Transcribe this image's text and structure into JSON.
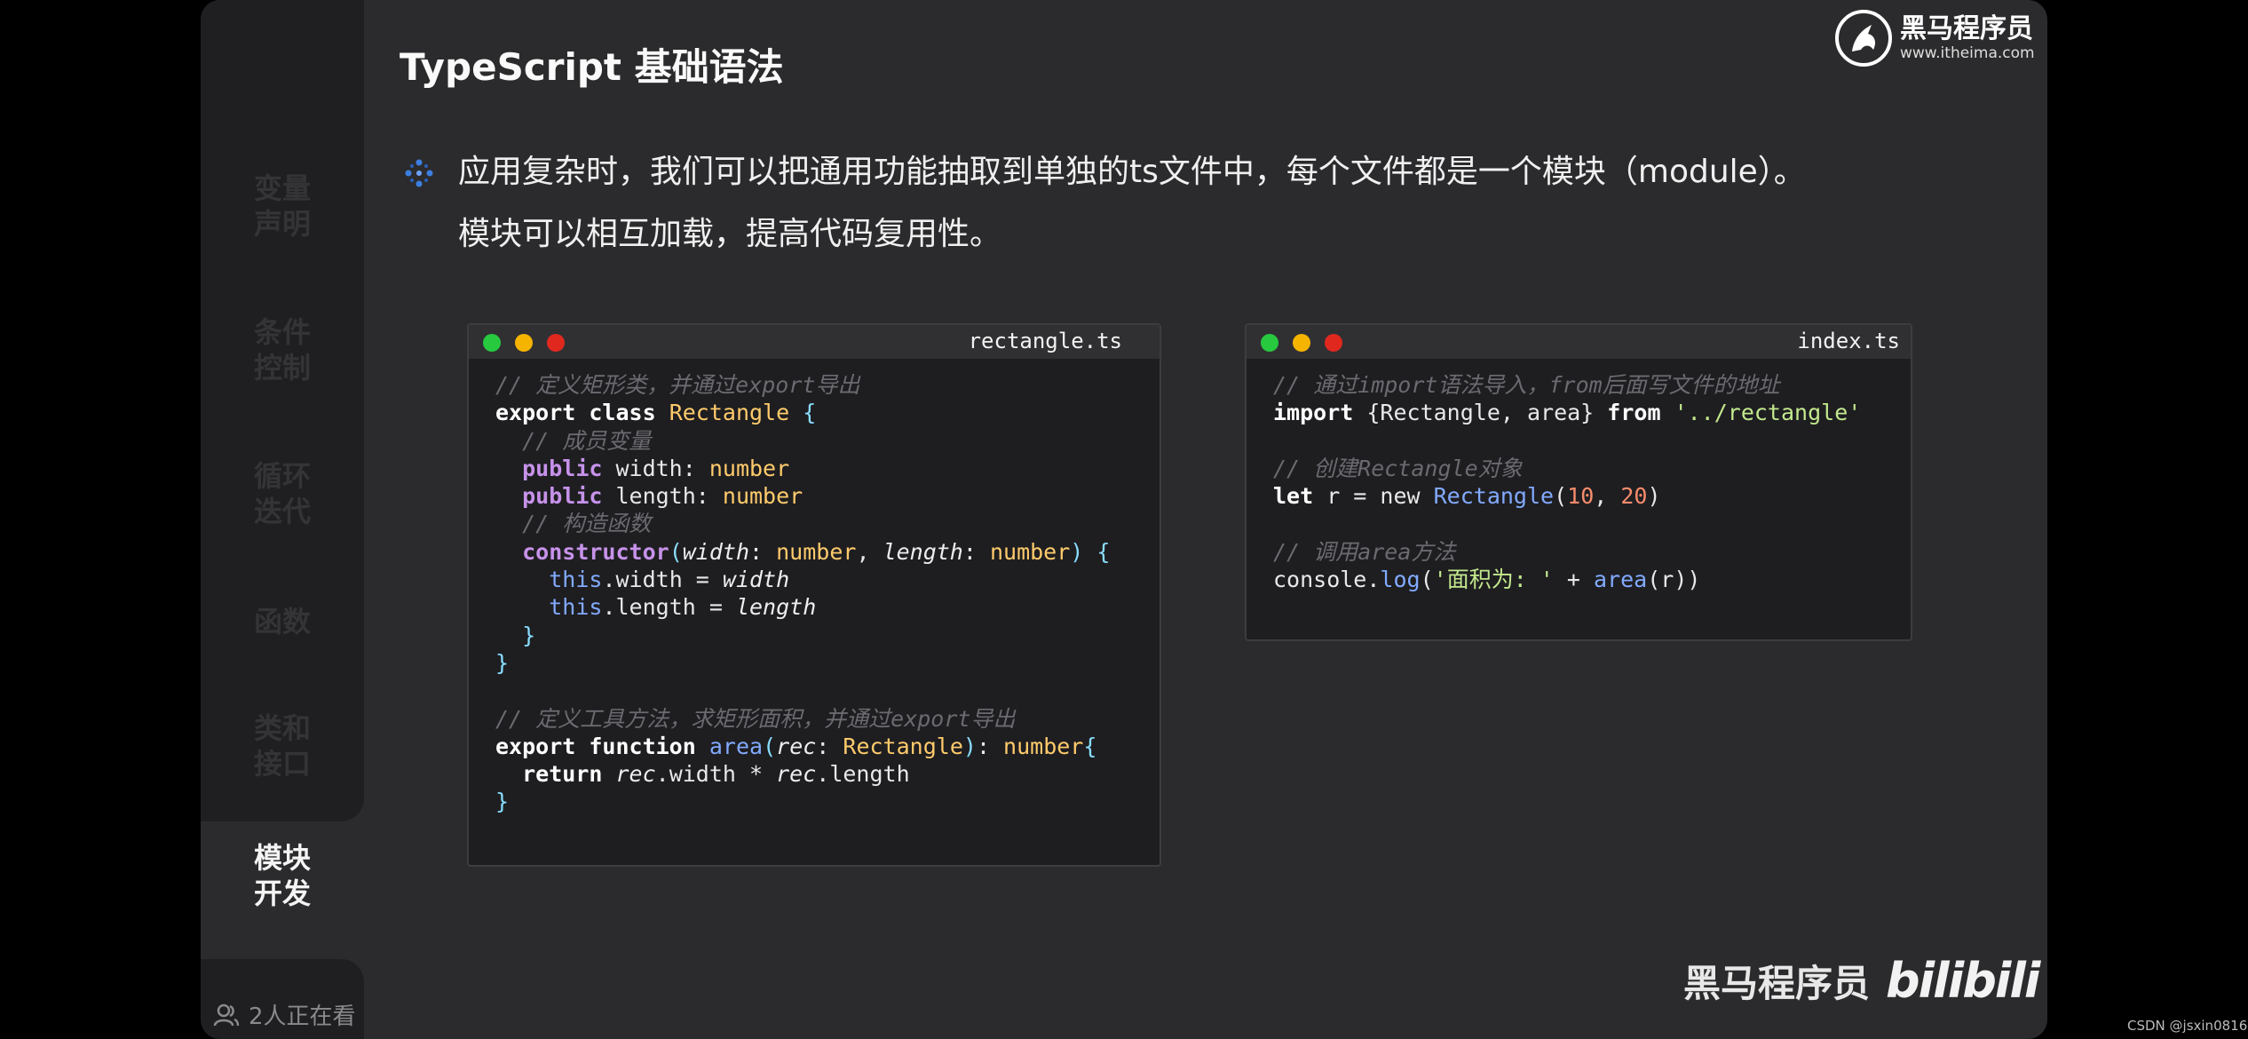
{
  "title": "TypeScript 基础语法",
  "logo": {
    "name": "黑马程序员",
    "url": "www.itheima.com"
  },
  "sidebar": {
    "items": [
      {
        "line1": "变量",
        "line2": "声明"
      },
      {
        "line1": "条件",
        "line2": "控制"
      },
      {
        "line1": "循环",
        "line2": "迭代"
      },
      {
        "line1": "函数",
        "line2": ""
      },
      {
        "line1": "类和",
        "line2": "接口"
      }
    ],
    "active": {
      "line1": "模块",
      "line2": "开发"
    },
    "viewers": "2人正在看"
  },
  "content": {
    "line1": "应用复杂时，我们可以把通用功能抽取到单独的ts文件中，每个文件都是一个模块（module）。",
    "line2": "模块可以相互加载，提高代码复用性。"
  },
  "windows": {
    "left": {
      "filename": "rectangle.ts"
    },
    "right": {
      "filename": "index.ts"
    }
  },
  "code_left": [
    [
      [
        "cm",
        "// 定义矩形类，并通过export导出"
      ]
    ],
    [
      [
        "kw2",
        "export"
      ],
      [
        "t",
        " "
      ],
      [
        "kw2",
        "class"
      ],
      [
        "t",
        " "
      ],
      [
        "ty",
        "Rectangle"
      ],
      [
        "t",
        " "
      ],
      [
        "pn",
        "{"
      ]
    ],
    [
      [
        "t",
        "  "
      ],
      [
        "cm",
        "// 成员变量"
      ]
    ],
    [
      [
        "t",
        "  "
      ],
      [
        "kw",
        "public"
      ],
      [
        "t",
        " width: "
      ],
      [
        "ty",
        "number"
      ]
    ],
    [
      [
        "t",
        "  "
      ],
      [
        "kw",
        "public"
      ],
      [
        "t",
        " length: "
      ],
      [
        "ty",
        "number"
      ]
    ],
    [
      [
        "t",
        "  "
      ],
      [
        "cm",
        "// 构造函数"
      ]
    ],
    [
      [
        "t",
        "  "
      ],
      [
        "kw",
        "constructor"
      ],
      [
        "pn",
        "("
      ],
      [
        "pm",
        "width"
      ],
      [
        "t",
        ": "
      ],
      [
        "ty",
        "number"
      ],
      [
        "t",
        ", "
      ],
      [
        "pm",
        "length"
      ],
      [
        "t",
        ": "
      ],
      [
        "ty",
        "number"
      ],
      [
        "pn",
        ")"
      ],
      [
        "t",
        " "
      ],
      [
        "pn",
        "{"
      ]
    ],
    [
      [
        "t",
        "    "
      ],
      [
        "fn",
        "this"
      ],
      [
        "t",
        ".width = "
      ],
      [
        "pm",
        "width"
      ]
    ],
    [
      [
        "t",
        "    "
      ],
      [
        "fn",
        "this"
      ],
      [
        "t",
        ".length = "
      ],
      [
        "pm",
        "length"
      ]
    ],
    [
      [
        "t",
        "  "
      ],
      [
        "pn",
        "}"
      ]
    ],
    [
      [
        "pn",
        "}"
      ]
    ],
    [
      [
        "t",
        ""
      ]
    ],
    [
      [
        "cm",
        "// 定义工具方法，求矩形面积，并通过export导出"
      ]
    ],
    [
      [
        "kw2",
        "export"
      ],
      [
        "t",
        " "
      ],
      [
        "kw2",
        "function"
      ],
      [
        "t",
        " "
      ],
      [
        "fn",
        "area"
      ],
      [
        "pn",
        "("
      ],
      [
        "pm",
        "rec"
      ],
      [
        "t",
        ": "
      ],
      [
        "ty",
        "Rectangle"
      ],
      [
        "pn",
        ")"
      ],
      [
        "t",
        ": "
      ],
      [
        "ty",
        "number"
      ],
      [
        "pn",
        "{"
      ]
    ],
    [
      [
        "t",
        "  "
      ],
      [
        "kw2",
        "return"
      ],
      [
        "t",
        " "
      ],
      [
        "pm",
        "rec"
      ],
      [
        "t",
        ".width * "
      ],
      [
        "pm",
        "rec"
      ],
      [
        "t",
        ".length"
      ]
    ],
    [
      [
        "pn",
        "}"
      ]
    ]
  ],
  "code_right": [
    [
      [
        "cm",
        "// 通过import语法导入，from后面写文件的地址"
      ]
    ],
    [
      [
        "kw2",
        "import"
      ],
      [
        "t",
        " {Rectangle, area} "
      ],
      [
        "kw2",
        "from"
      ],
      [
        "t",
        " "
      ],
      [
        "st",
        "'../rectangle'"
      ]
    ],
    [
      [
        "t",
        ""
      ]
    ],
    [
      [
        "cm",
        "// 创建Rectangle对象"
      ]
    ],
    [
      [
        "kw2",
        "let"
      ],
      [
        "t",
        " r = new "
      ],
      [
        "fn",
        "Rectangle"
      ],
      [
        "t",
        "("
      ],
      [
        "nm",
        "10"
      ],
      [
        "t",
        ", "
      ],
      [
        "nm",
        "20"
      ],
      [
        "t",
        ")"
      ]
    ],
    [
      [
        "t",
        ""
      ]
    ],
    [
      [
        "cm",
        "// 调用area方法"
      ]
    ],
    [
      [
        "t",
        "console."
      ],
      [
        "fn",
        "log"
      ],
      [
        "t",
        "("
      ],
      [
        "st",
        "'面积为: '"
      ],
      [
        "t",
        " + "
      ],
      [
        "fn",
        "area"
      ],
      [
        "t",
        "(r))"
      ]
    ]
  ],
  "footer": {
    "brand": "黑马程序员",
    "platform": "bilibili",
    "watermark": "CSDN @jsxin0816"
  },
  "colors": {
    "dot_green": "#27c93f",
    "dot_yellow": "#f5b400",
    "dot_red": "#e0281f",
    "bullet": "#3d7fe0"
  }
}
